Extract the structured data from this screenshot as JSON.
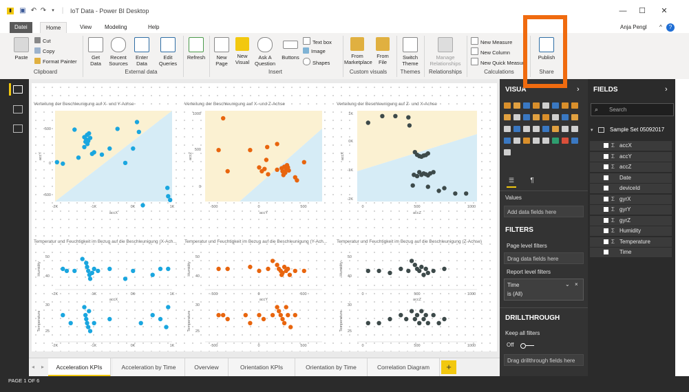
{
  "window": {
    "title": "IoT Data - Power BI Desktop",
    "user": "Anja Pengl",
    "controls": [
      "—",
      "☐",
      "✕"
    ]
  },
  "menu": {
    "tabs": [
      "Datei",
      "Home",
      "View",
      "Modeling",
      "Help"
    ]
  },
  "ribbon": {
    "paste": "Paste",
    "cut": "Cut",
    "copy": "Copy",
    "format_painter": "Format Painter",
    "get_data": "Get Data",
    "recent_sources": "Recent Sources",
    "enter_data": "Enter Data",
    "edit_queries": "Edit Queries",
    "refresh": "Refresh",
    "new_page": "New Page",
    "new_visual": "New Visual",
    "ask_question": "Ask A Question",
    "buttons": "Buttons",
    "text_box": "Text box",
    "image": "Image",
    "shapes": "Shapes",
    "from_marketplace": "From Marketplace",
    "from_file": "From File",
    "switch_theme": "Switch Theme",
    "manage_relationships": "Manage Relationships",
    "new_measure": "New Measure",
    "new_column": "New Column",
    "new_quick_measure": "New Quick Measure",
    "publish": "Publish",
    "groups": [
      "Clipboard",
      "External data",
      "Insert",
      "Custom visuals",
      "Themes",
      "Relationships",
      "Calculations",
      "Share"
    ]
  },
  "charts": {
    "c1": {
      "title": "Verteilung der Beschleunigung auf X- und Y-Achse",
      "xlabel": "accX",
      "ylabel": "accY"
    },
    "c2": {
      "title": "Verteilung der Beschleunigung auf X- und Z-Achse",
      "xlabel": "accY",
      "ylabel": "accZ"
    },
    "c3": {
      "title": "Verteilung der Beschleunigung auf Z- und X-Achse",
      "xlabel": "accZ",
      "ylabel": "accX"
    },
    "c4": {
      "title": "Temperatur und Feuchtigkeit im Bezug auf die Beschleunigung (X-Ach...",
      "xlabel": "accX",
      "ylabel_top": "Humidity",
      "ylabel_bottom": "Temperature"
    },
    "c5": {
      "title": "Temperatur und Feuchtigkeit im Bezug auf die Beschleunigung (Y-Ach...",
      "xlabel": "accY",
      "ylabel_top": "Humidity",
      "ylabel_bottom": "Temperature"
    },
    "c6": {
      "title": "Temperatur und Feuchtigkeit im Bezug auf die Beschleunigung (Z-Achse)",
      "xlabel": "accZ",
      "ylabel_top": "Humidity",
      "ylabel_bottom": "Temperature"
    }
  },
  "chart_data": [
    {
      "type": "scatter",
      "title": "Verteilung der Beschleunigung auf X- und Y-Achse",
      "xlabel": "accX",
      "ylabel": "accY",
      "color": "#1aa6df",
      "xticks": [
        "-2K",
        "-1K",
        "0K",
        "1K"
      ],
      "yticks": [
        "500",
        "0",
        "-500"
      ],
      "xlim": [
        -2000,
        1000
      ],
      "ylim": [
        -600,
        600
      ],
      "points": [
        [
          -1250,
          250
        ],
        [
          -1200,
          220
        ],
        [
          -1180,
          280
        ],
        [
          -1150,
          200
        ],
        [
          -1100,
          240
        ],
        [
          -1220,
          190
        ],
        [
          -1130,
          300
        ],
        [
          -1170,
          160
        ],
        [
          -1250,
          120
        ],
        [
          -1500,
          350
        ],
        [
          -1800,
          -100
        ],
        [
          -1950,
          -80
        ],
        [
          -1000,
          50
        ],
        [
          -1050,
          30
        ],
        [
          -1400,
          -20
        ],
        [
          -800,
          20
        ],
        [
          -600,
          100
        ],
        [
          -200,
          -90
        ],
        [
          -400,
          360
        ],
        [
          0,
          100
        ],
        [
          100,
          450
        ],
        [
          150,
          320
        ],
        [
          250,
          -650
        ],
        [
          880,
          -420
        ],
        [
          900,
          -530
        ],
        [
          950,
          -580
        ]
      ]
    },
    {
      "type": "scatter",
      "title": "Verteilung der Beschleunigung auf X- und Z-Achse",
      "xlabel": "accY",
      "ylabel": "accZ",
      "color": "#e8650e",
      "xticks": [
        "-500",
        "0",
        "500"
      ],
      "yticks": [
        "1000",
        "500",
        "0"
      ],
      "xlim": [
        -600,
        700
      ],
      "ylim": [
        -200,
        1000
      ],
      "points": [
        [
          -400,
          900
        ],
        [
          -450,
          480
        ],
        [
          -350,
          200
        ],
        [
          -100,
          480
        ],
        [
          0,
          250
        ],
        [
          30,
          200
        ],
        [
          60,
          230
        ],
        [
          80,
          350
        ],
        [
          90,
          520
        ],
        [
          100,
          160
        ],
        [
          200,
          220
        ],
        [
          250,
          240
        ],
        [
          260,
          200
        ],
        [
          280,
          260
        ],
        [
          300,
          230
        ],
        [
          320,
          250
        ],
        [
          330,
          210
        ],
        [
          290,
          180
        ],
        [
          310,
          280
        ],
        [
          270,
          150
        ],
        [
          400,
          120
        ],
        [
          420,
          80
        ],
        [
          500,
          320
        ],
        [
          200,
          560
        ]
      ]
    },
    {
      "type": "scatter",
      "title": "Verteilung der Beschleunigung auf Z- und X-Achse",
      "xlabel": "accZ",
      "ylabel": "accX",
      "color": "#3d4a4a",
      "xticks": [
        "0",
        "500",
        "1000"
      ],
      "yticks": [
        "1K",
        "0K",
        "-1K",
        "-2K"
      ],
      "xlim": [
        -50,
        1050
      ],
      "ylim": [
        -2200,
        1200
      ],
      "points": [
        [
          180,
          1000
        ],
        [
          300,
          1000
        ],
        [
          420,
          950
        ],
        [
          50,
          750
        ],
        [
          430,
          650
        ],
        [
          480,
          -350
        ],
        [
          500,
          -450
        ],
        [
          520,
          -500
        ],
        [
          540,
          -520
        ],
        [
          560,
          -480
        ],
        [
          580,
          -460
        ],
        [
          600,
          -400
        ],
        [
          520,
          -1100
        ],
        [
          540,
          -1200
        ],
        [
          560,
          -1150
        ],
        [
          580,
          -1180
        ],
        [
          600,
          -1220
        ],
        [
          620,
          -1150
        ],
        [
          470,
          -1200
        ],
        [
          500,
          -1250
        ],
        [
          650,
          -1100
        ],
        [
          460,
          -1600
        ],
        [
          600,
          -1650
        ],
        [
          700,
          -1800
        ],
        [
          750,
          -1700
        ],
        [
          850,
          -1900
        ],
        [
          950,
          -1900
        ]
      ]
    },
    {
      "type": "scatter",
      "title": "Temperatur und Feuchtigkeit im Bezug auf die Beschleunigung (X-Ach...",
      "xlabel": "accX",
      "ylabels": [
        "Humidity",
        "Temperature"
      ],
      "color": "#1aa6df",
      "xticks": [
        "-2K",
        "-1K",
        "0K",
        "1K"
      ],
      "yticks_top": [
        "50",
        "40"
      ],
      "yticks_bottom": [
        "30",
        "25"
      ],
      "series": [
        {
          "name": "Humidity",
          "points": [
            [
              -1800,
              45
            ],
            [
              -1700,
              44
            ],
            [
              -1500,
              44
            ],
            [
              -1300,
              50
            ],
            [
              -1200,
              48
            ],
            [
              -1180,
              46
            ],
            [
              -1150,
              44
            ],
            [
              -1120,
              42
            ],
            [
              -1100,
              40
            ],
            [
              -1050,
              43
            ],
            [
              -1000,
              45
            ],
            [
              -900,
              44
            ],
            [
              -600,
              45
            ],
            [
              -200,
              40
            ],
            [
              0,
              44
            ],
            [
              500,
              42
            ],
            [
              700,
              45
            ],
            [
              900,
              45
            ]
          ]
        },
        {
          "name": "Temperature",
          "points": [
            [
              -1800,
              28
            ],
            [
              -1600,
              26
            ],
            [
              -1250,
              30
            ],
            [
              -1220,
              28
            ],
            [
              -1200,
              27
            ],
            [
              -1180,
              26
            ],
            [
              -1150,
              25
            ],
            [
              -1130,
              29
            ],
            [
              -1100,
              24
            ],
            [
              -1000,
              26
            ],
            [
              -600,
              27
            ],
            [
              200,
              26
            ],
            [
              500,
              28
            ],
            [
              700,
              27
            ],
            [
              850,
              25
            ],
            [
              900,
              30
            ]
          ]
        }
      ]
    },
    {
      "type": "scatter",
      "title": "Temperatur und Feuchtigkeit im Bezug auf die Beschleunigung (Y-Ach...",
      "xlabel": "accY",
      "ylabels": [
        "Humidity",
        "Temperature"
      ],
      "color": "#e8650e",
      "xticks": [
        "-500",
        "0",
        "500"
      ],
      "yticks_top": [
        "50",
        "40"
      ],
      "yticks_bottom": [
        "30",
        "25"
      ],
      "series": [
        {
          "name": "Humidity",
          "points": [
            [
              -450,
              45
            ],
            [
              -350,
              45
            ],
            [
              -100,
              46
            ],
            [
              0,
              44
            ],
            [
              100,
              45
            ],
            [
              150,
              49
            ],
            [
              200,
              47
            ],
            [
              220,
              45
            ],
            [
              240,
              44
            ],
            [
              250,
              42
            ],
            [
              260,
              43
            ],
            [
              280,
              46
            ],
            [
              300,
              44
            ],
            [
              320,
              45
            ],
            [
              340,
              42
            ],
            [
              400,
              44
            ],
            [
              500,
              44
            ]
          ]
        },
        {
          "name": "Temperature",
          "points": [
            [
              -450,
              28
            ],
            [
              -400,
              28
            ],
            [
              -350,
              27
            ],
            [
              -150,
              28
            ],
            [
              -100,
              26
            ],
            [
              0,
              28
            ],
            [
              50,
              27
            ],
            [
              150,
              28
            ],
            [
              200,
              30
            ],
            [
              220,
              29
            ],
            [
              240,
              28
            ],
            [
              260,
              27
            ],
            [
              280,
              26
            ],
            [
              300,
              30
            ],
            [
              320,
              28
            ],
            [
              350,
              25
            ],
            [
              400,
              28
            ]
          ]
        }
      ]
    },
    {
      "type": "scatter",
      "title": "Temperatur und Feuchtigkeit im Bezug auf die Beschleunigung (Z-Achse)",
      "xlabel": "accZ",
      "ylabels": [
        "Humidity",
        "Temperature"
      ],
      "color": "#3d4a4a",
      "xticks": [
        "0",
        "500",
        "1000"
      ],
      "yticks_top": [
        "50",
        "40"
      ],
      "yticks_bottom": [
        "30",
        "25"
      ],
      "series": [
        {
          "name": "Humidity",
          "points": [
            [
              50,
              44
            ],
            [
              150,
              44
            ],
            [
              250,
              43
            ],
            [
              350,
              45
            ],
            [
              420,
              44
            ],
            [
              450,
              49
            ],
            [
              480,
              47
            ],
            [
              500,
              45
            ],
            [
              520,
              44
            ],
            [
              540,
              46
            ],
            [
              560,
              42
            ],
            [
              580,
              45
            ],
            [
              600,
              43
            ],
            [
              650,
              44
            ],
            [
              750,
              45
            ]
          ]
        },
        {
          "name": "Temperature",
          "points": [
            [
              50,
              26
            ],
            [
              150,
              26
            ],
            [
              250,
              27
            ],
            [
              350,
              28
            ],
            [
              400,
              27
            ],
            [
              450,
              29
            ],
            [
              480,
              27
            ],
            [
              500,
              28
            ],
            [
              520,
              26
            ],
            [
              540,
              29
            ],
            [
              560,
              27
            ],
            [
              580,
              28
            ],
            [
              600,
              26
            ],
            [
              650,
              28
            ],
            [
              700,
              26
            ],
            [
              750,
              27
            ]
          ]
        }
      ]
    }
  ],
  "page_tabs": [
    "Acceleration KPIs",
    "Acceleration by Time",
    "Overview",
    "Orientation KPIs",
    "Orientation by Time",
    "Correlation Diagram"
  ],
  "status": {
    "page_info": "PAGE 1 OF 6"
  },
  "visualizations": {
    "title": "VISUA",
    "values_label": "Values",
    "values_placeholder": "Add data fields here",
    "filters_title": "FILTERS",
    "page_level": "Page level filters",
    "page_placeholder": "Drag data fields here",
    "report_level": "Report level filters",
    "filter_field": "Time",
    "filter_value": "is (All)",
    "drillthrough_title": "DRILLTHROUGH",
    "keep_all": "Keep all filters",
    "toggle_state": "Off",
    "drill_placeholder": "Drag drillthrough fields here"
  },
  "fields": {
    "title": "FIELDS",
    "search_placeholder": "Search",
    "table": "Sample Set 05092017",
    "items": [
      {
        "name": "accX",
        "sigma": "Σ"
      },
      {
        "name": "accY",
        "sigma": "Σ"
      },
      {
        "name": "accZ",
        "sigma": "Σ"
      },
      {
        "name": "Date",
        "sigma": ""
      },
      {
        "name": "deviceId",
        "sigma": ""
      },
      {
        "name": "gyrX",
        "sigma": "Σ"
      },
      {
        "name": "gyrY",
        "sigma": "Σ"
      },
      {
        "name": "gyrZ",
        "sigma": "Σ"
      },
      {
        "name": "Humidity",
        "sigma": "Σ"
      },
      {
        "name": "Temperature",
        "sigma": "Σ"
      },
      {
        "name": "Time",
        "sigma": ""
      }
    ]
  },
  "colors": {
    "accent": "#f2c80f",
    "highlight": "#f06b0f",
    "series_blue": "#1aa6df",
    "series_orange": "#e8650e",
    "series_dark": "#3d4a4a"
  }
}
